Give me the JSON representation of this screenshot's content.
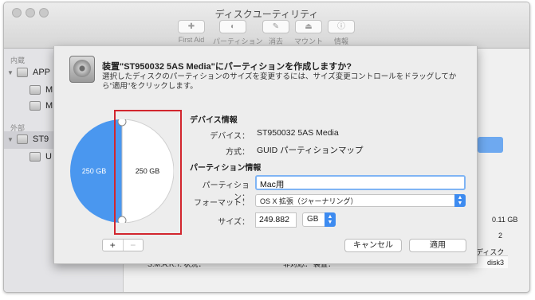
{
  "window": {
    "title": "ディスクユーティリティ"
  },
  "toolbar": [
    {
      "label": "First Aid",
      "icon": "first-aid-icon"
    },
    {
      "label": "パーティション",
      "icon": "partition-icon"
    },
    {
      "label": "消去",
      "icon": "erase-icon"
    },
    {
      "label": "マウント",
      "icon": "mount-icon"
    },
    {
      "label": "情報",
      "icon": "info-icon"
    }
  ],
  "sidebar": {
    "internal_header": "内蔵",
    "external_header": "外部",
    "items": [
      {
        "label": "APP"
      },
      {
        "label": "M"
      },
      {
        "label": "M"
      },
      {
        "label": "ST9"
      },
      {
        "label": "U"
      }
    ]
  },
  "background": {
    "cells": [
      "0.11 GB",
      "2",
      "ディスク",
      "disk3"
    ],
    "table_row": [
      "S.M.A.R.T. 状況：",
      "非対応：",
      "装置："
    ]
  },
  "sheet": {
    "title": "装置\"ST950032 5AS Media\"にパーティションを作成しますか?",
    "description": "選択したディスクのパーティションのサイズを変更するには、サイズ変更コントロールをドラッグしてから\"適用\"をクリックします。",
    "pie": {
      "left_label": "250 GB",
      "right_label": "250 GB",
      "left_color": "#4a97ef",
      "right_color": "#ffffff"
    },
    "device_info": {
      "heading": "デバイス情報",
      "device_label": "デバイス：",
      "device_value": "ST950032 5AS Media",
      "scheme_label": "方式：",
      "scheme_value": "GUID パーティションマップ"
    },
    "partition_info": {
      "heading": "パーティション情報",
      "name_label": "パーティション：",
      "name_value": "Mac用",
      "format_label": "フォーマット：",
      "format_value": "OS X 拡張（ジャーナリング）",
      "size_label": "サイズ：",
      "size_value": "249.882",
      "size_unit": "GB"
    },
    "buttons": {
      "add": "+",
      "remove": "−",
      "cancel": "キャンセル",
      "apply": "適用"
    }
  }
}
